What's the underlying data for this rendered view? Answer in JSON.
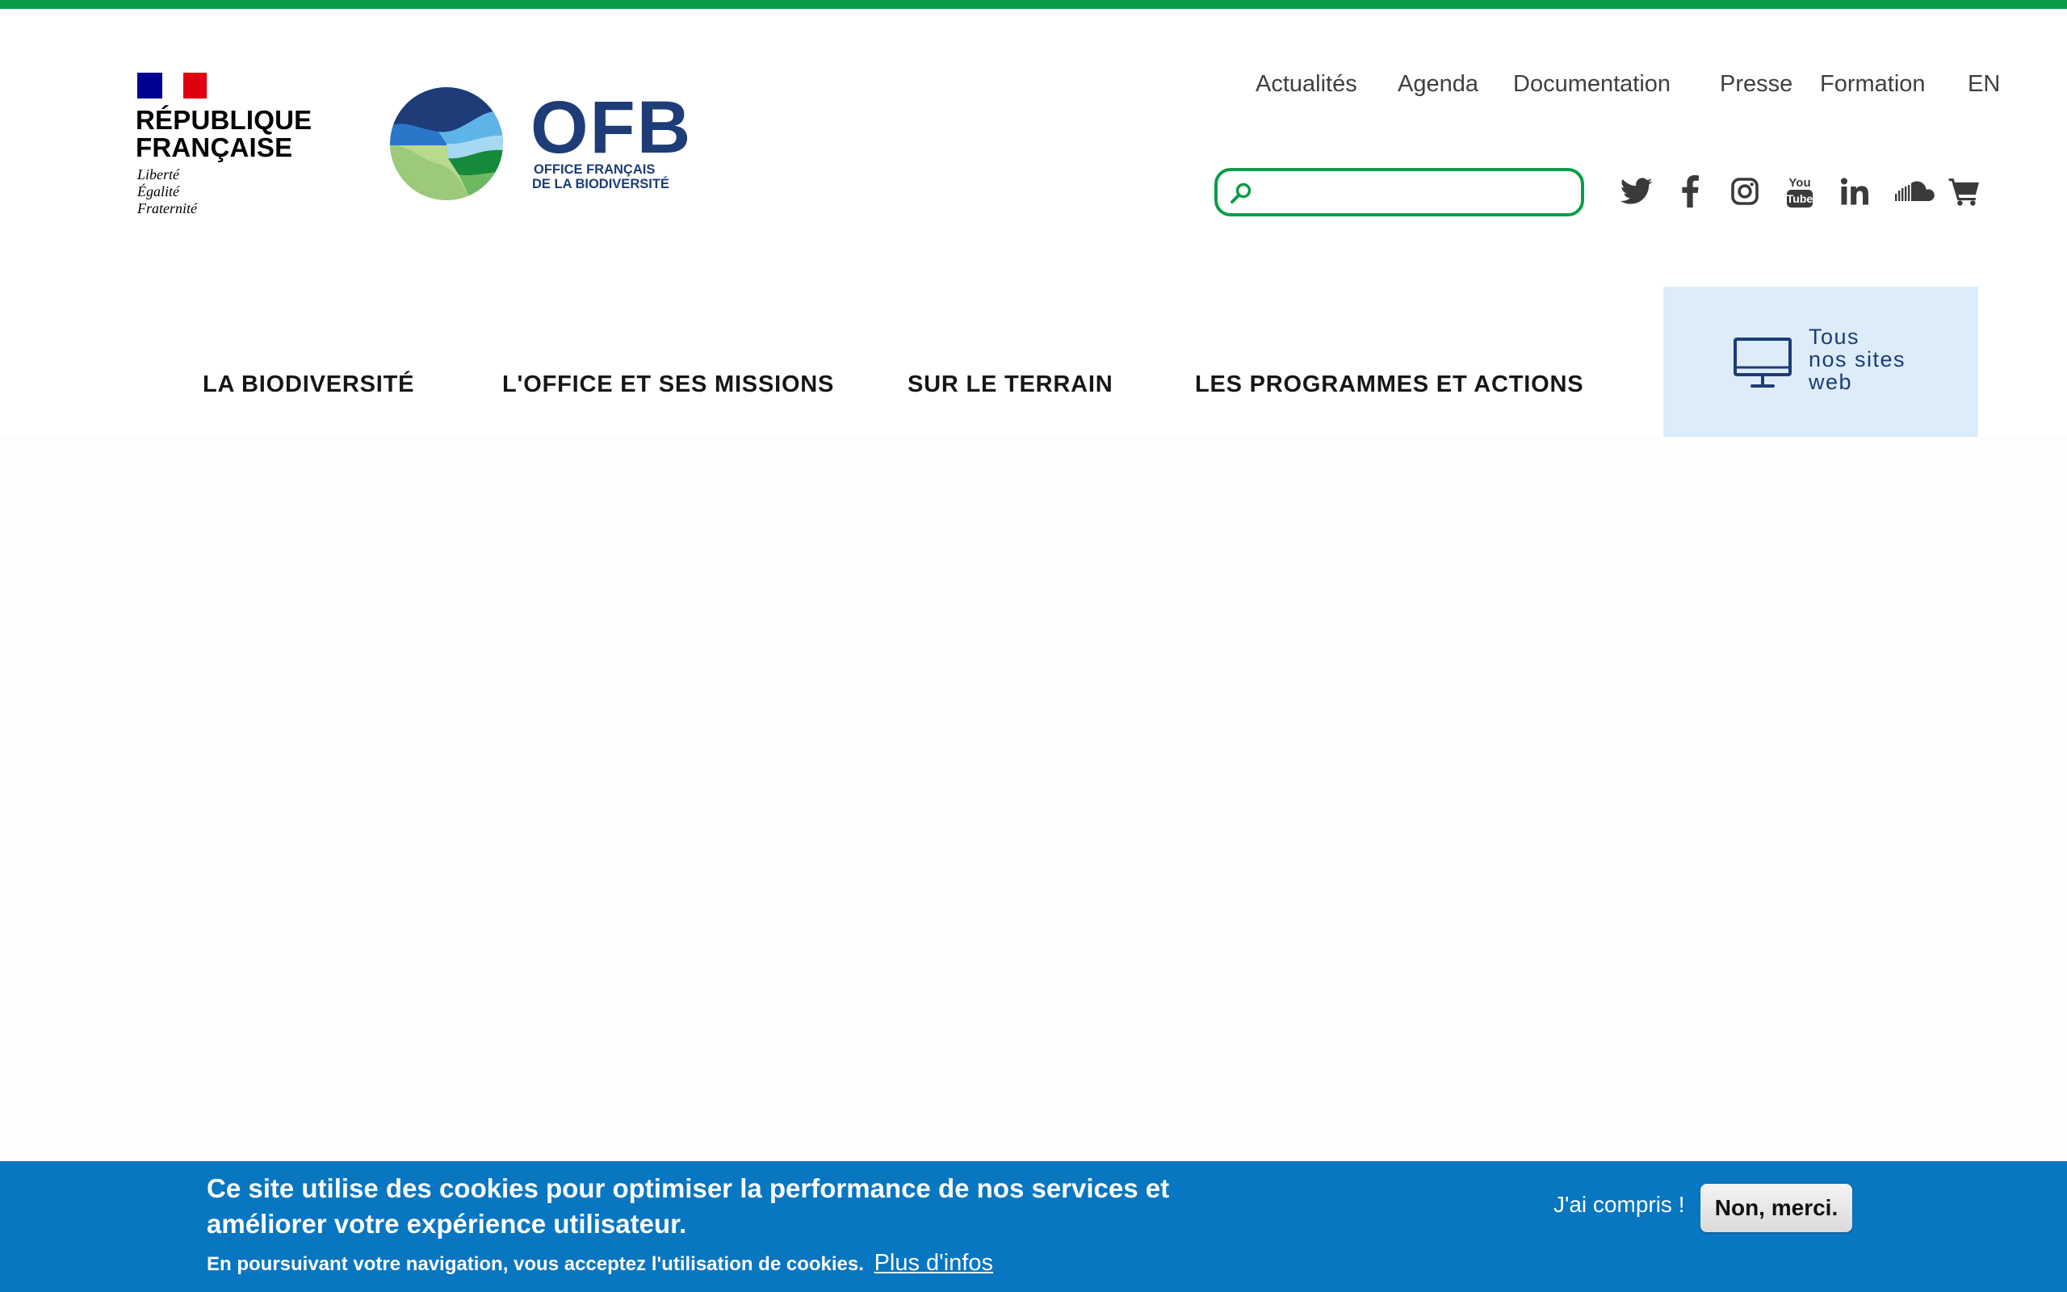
{
  "header": {
    "republique": {
      "name_line1": "RÉPUBLIQUE",
      "name_line2": "FRANÇAISE",
      "motto1": "Liberté",
      "motto2": "Égalité",
      "motto3": "Fraternité"
    },
    "logo": {
      "letters": "OFB",
      "sub_line1": "OFFICE FRANÇAIS",
      "sub_line2": "DE LA BIODIVERSITÉ"
    }
  },
  "top_links": [
    "Actualités",
    "Agenda",
    "Documentation",
    "Presse",
    "Formation",
    "EN"
  ],
  "search": {
    "value": "",
    "placeholder": ""
  },
  "social_icons": [
    "twitter-icon",
    "facebook-icon",
    "instagram-icon",
    "youtube-icon",
    "linkedin-icon",
    "soundcloud-icon",
    "cart-icon"
  ],
  "main_nav": {
    "items": [
      "LA BIODIVERSITÉ",
      "L'OFFICE ET SES MISSIONS",
      "SUR LE TERRAIN",
      "LES PROGRAMMES ET ACTIONS"
    ],
    "all_sites": {
      "line1": "Tous",
      "line2": "nos sites",
      "line3": "web"
    }
  },
  "cookie_banner": {
    "title_line1": "Ce site utilise des cookies pour optimiser la performance de nos services et",
    "title_line2": "améliorer votre expérience utilisateur.",
    "subtitle": "En poursuivant votre navigation, vous acceptez l'utilisation de cookies.",
    "more_link": "Plus d'infos",
    "accept": "J'ai compris !",
    "decline": "Non, merci."
  },
  "colors": {
    "accent_green": "#0b9c4a",
    "brand_navy": "#1d3c78",
    "banner_blue": "#0876c1",
    "all_sites_bg": "#dcedf9"
  }
}
